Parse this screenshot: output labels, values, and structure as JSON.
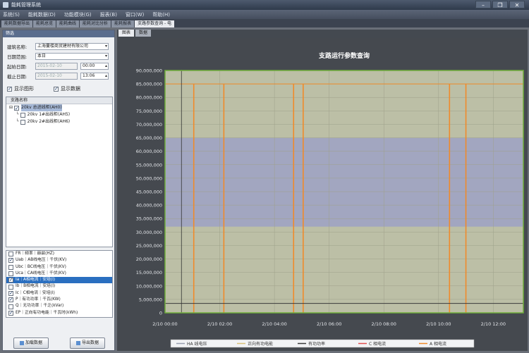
{
  "window": {
    "title": "能耗管理系统"
  },
  "menu": [
    "系统(S)",
    "能耗数据(D)",
    "功能模块(G)",
    "报表(B)",
    "窗口(W)",
    "帮助(H)"
  ],
  "doc_tabs": [
    {
      "label": "能耗数据导出",
      "active": false
    },
    {
      "label": "能耗总览",
      "active": false
    },
    {
      "label": "能耗曲线",
      "active": false
    },
    {
      "label": "能耗对比分析",
      "active": false
    },
    {
      "label": "能耗报表",
      "active": false
    },
    {
      "label": "支路参数查询 - 电",
      "active": true
    }
  ],
  "filter": {
    "header": "筛选",
    "building_label": "建筑名称:",
    "building_value": "上海蔓楼商贸建材有限公司",
    "range_label": "日期范围:",
    "range_value": "本日",
    "start_label": "起始日期:",
    "start_date": "2015-02-10",
    "start_time": "00:00",
    "end_label": "截止日期:",
    "end_date": "2015-02-10",
    "end_time": "13:06",
    "show_grid_label": "显示图形",
    "show_data_label": "显示数据"
  },
  "tree": {
    "header": "支路名称",
    "nodes": [
      {
        "label": "20kv 总进线柜(AH0)",
        "indent": 0,
        "selected": true
      },
      {
        "label": "20kv 1#出线柜(AH5)",
        "indent": 1,
        "selected": false
      },
      {
        "label": "20kv 2#出线柜(AH6)",
        "indent": 1,
        "selected": false
      }
    ]
  },
  "params": [
    {
      "label": "FR｜频率｜赫兹(HZ)",
      "checked": false,
      "selected": false
    },
    {
      "label": "Uab｜AB线电压｜千伏(KV)",
      "checked": true,
      "selected": false
    },
    {
      "label": "Ubc｜BC线电压｜千伏(KV)",
      "checked": false,
      "selected": false
    },
    {
      "label": "Uca｜CA线电压｜千伏(KV)",
      "checked": false,
      "selected": false
    },
    {
      "label": "Ia｜A相电流｜安培(I)",
      "checked": true,
      "selected": true
    },
    {
      "label": "Ib｜B相电流｜安培(I)",
      "checked": false,
      "selected": false
    },
    {
      "label": "Ic｜C相电流｜安培(I)",
      "checked": true,
      "selected": false
    },
    {
      "label": "P｜有功功率｜千瓦(KW)",
      "checked": true,
      "selected": false
    },
    {
      "label": "Q｜无功功率｜千乏(kVar)",
      "checked": false,
      "selected": false
    },
    {
      "label": "EP｜正向有功电能｜千瓦时(kWh)",
      "checked": true,
      "selected": false
    }
  ],
  "buttons": {
    "add": "加载数据",
    "export": "导出数据"
  },
  "subtabs": [
    "图表",
    "数据"
  ],
  "chart_data": {
    "type": "line",
    "title": "支路运行参数查询",
    "y_ticks": [
      0,
      5000000,
      10000000,
      15000000,
      20000000,
      25000000,
      30000000,
      35000000,
      40000000,
      45000000,
      50000000,
      55000000,
      60000000,
      65000000,
      70000000,
      75000000,
      80000000,
      85000000,
      90000000
    ],
    "y_tick_labels": [
      "0",
      "5,000,000",
      "10,000,000",
      "15,000,000",
      "20,000,000",
      "25,000,000",
      "30,000,000",
      "35,000,000",
      "40,000,000",
      "45,000,000",
      "50,000,000",
      "55,000,000",
      "60,000,000",
      "65,000,000",
      "70,000,000",
      "75,000,000",
      "80,000,000",
      "85,000,000",
      "90,000,000"
    ],
    "ylim": [
      0,
      90000000
    ],
    "x_tick_labels": [
      "2/10 00:00",
      "2/10 02:00",
      "2/10 04:00",
      "2/10 06:00",
      "2/10 08:00",
      "2/10 10:00",
      "2/10 12:00"
    ],
    "x_hours": [
      0,
      2,
      4,
      6,
      8,
      10,
      12
    ],
    "xlim": [
      0,
      13.1
    ],
    "band_range": [
      32000000,
      65000000
    ],
    "band_color": "#9da1c4",
    "background_color": "#bcbfa6",
    "spikes": {
      "name": "",
      "color": "#f08a2a",
      "baseline": 0,
      "peak": 85000000,
      "hours": [
        1.05,
        2.15,
        4.7,
        5.05,
        10.4,
        11.0
      ]
    },
    "baseline_series": {
      "color": "#3a3a3a",
      "value": 3500000
    },
    "cursor_hour": 0.6,
    "grid": true,
    "legend_position": "bottom",
    "legend": [
      {
        "name": "HA 线电压",
        "color": "#9aa0b0"
      },
      {
        "name": "正向有功电能",
        "color": "#d9c17a"
      },
      {
        "name": "有功功率",
        "color": "#3a3a3a"
      },
      {
        "name": "C 相电流",
        "color": "#e05050"
      },
      {
        "name": "A 相电流",
        "color": "#f08a2a"
      }
    ]
  }
}
